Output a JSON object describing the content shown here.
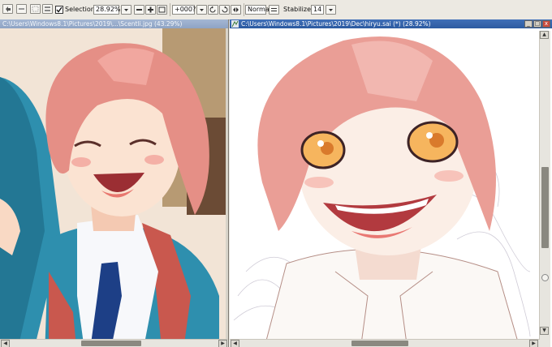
{
  "toolbar": {
    "selection_label": "Selection",
    "selection_checked": true,
    "zoom_value": "28.92%",
    "rotation_value": "+000?",
    "blend_mode": "Normal",
    "stabilizer_label": "Stabilizer",
    "stabilizer_value": "14"
  },
  "reference_window": {
    "title": "C:\\Users\\Windows8.1\\Pictures\\2019\\...\\Scentli.jpg (43.29%)"
  },
  "canvas_window": {
    "title": "C:\\Users\\Windows8.1\\Pictures\\2019\\Dec\\hiryu.sai (*) (28.92%)",
    "win_buttons": [
      "_",
      "□",
      "x"
    ]
  },
  "colors": {
    "titlebar_active": "#2c5aa0",
    "titlebar_inactive": "#8ea3c4",
    "toolbar_bg": "#ece9e2",
    "hair": "#e58f86",
    "jacket": "#2e8fae",
    "skin": "#fbe3d2"
  }
}
